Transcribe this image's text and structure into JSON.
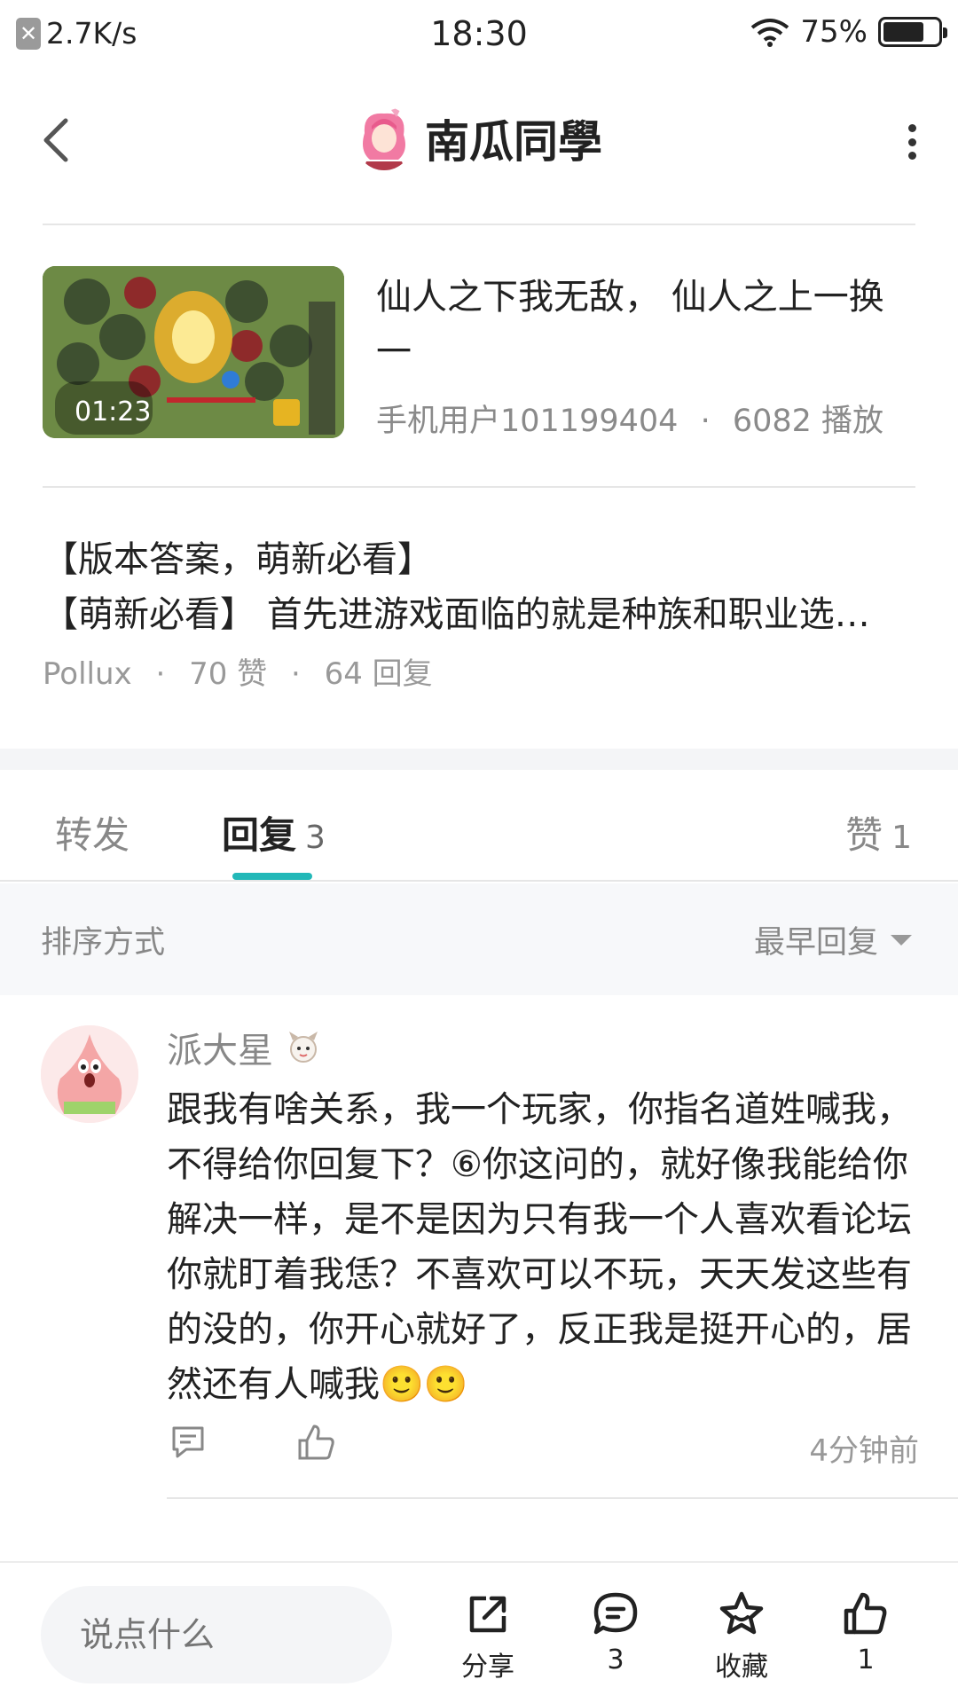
{
  "status_bar": {
    "net_speed": "2.7K/s",
    "time": "18:30",
    "battery": "75%",
    "battery_level": 0.75
  },
  "header": {
    "title": "南瓜同學",
    "avatar_icon": "anime-avatar-pink-hair"
  },
  "video": {
    "title": "仙人之下我无敌， 仙人之上一换一",
    "duration": "01:23",
    "author": "手机用户101199404",
    "sep": "·",
    "plays": "6082 播放"
  },
  "post": {
    "title": "【版本答案，萌新必看】",
    "excerpt": "【萌新必看】 首先进游戏面临的就是种族和职业选…",
    "author": "Pollux",
    "sep": "·",
    "likes": "70 赞",
    "replies": "64 回复"
  },
  "tabs": {
    "forward": "转发",
    "reply": "回复",
    "reply_count": "3",
    "like": "赞",
    "like_count": "1"
  },
  "sort": {
    "label": "排序方式",
    "value": "最早回复"
  },
  "comment": {
    "username": "派大星",
    "avatar_icon": "patrick-star-avatar",
    "badge_icon": "chibi-badge-icon",
    "text": "跟我有啥关系，我一个玩家，你指名道姓喊我，不得给你回复下？⑥你这问的，就好像我能给你解决一样，是不是因为只有我一个人喜欢看论坛你就盯着我恁？不喜欢可以不玩，天天发这些有的没的，你开心就好了，反正我是挺开心的，居然还有人喊我🙂🙂",
    "time": "4分钟前"
  },
  "bottom_bar": {
    "input_placeholder": "说点什么",
    "share_label": "分享",
    "comment_count": "3",
    "favorite_label": "收藏",
    "like_count": "1"
  },
  "colors": {
    "accent": "#22b8b8",
    "text_primary": "#222222",
    "text_secondary": "#888888"
  }
}
